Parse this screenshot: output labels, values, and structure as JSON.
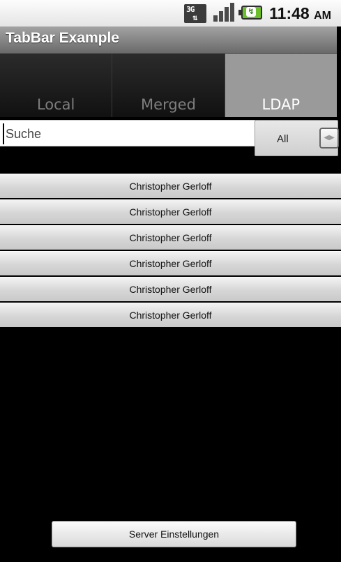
{
  "status_bar": {
    "network": "3G",
    "time": "11:48",
    "ampm": "AM",
    "icons": [
      "3g-data-icon",
      "signal-strength-icon",
      "battery-charging-icon"
    ]
  },
  "title_bar": {
    "title": "TabBar Example"
  },
  "tabs": [
    {
      "label": "Local",
      "selected": false
    },
    {
      "label": "Merged",
      "selected": false
    },
    {
      "label": "LDAP",
      "selected": true
    }
  ],
  "search": {
    "placeholder": "Suche",
    "value": ""
  },
  "filter": {
    "selected": "All"
  },
  "list": [
    "Christopher Gerloff",
    "Christopher Gerloff",
    "Christopher Gerloff",
    "Christopher Gerloff",
    "Christopher Gerloff",
    "Christopher Gerloff"
  ],
  "footer": {
    "button_label": "Server Einstellungen"
  },
  "colors": {
    "background": "#000000",
    "tab_selected": "#9a9a9a",
    "titlebar": "#8a8a8a"
  }
}
